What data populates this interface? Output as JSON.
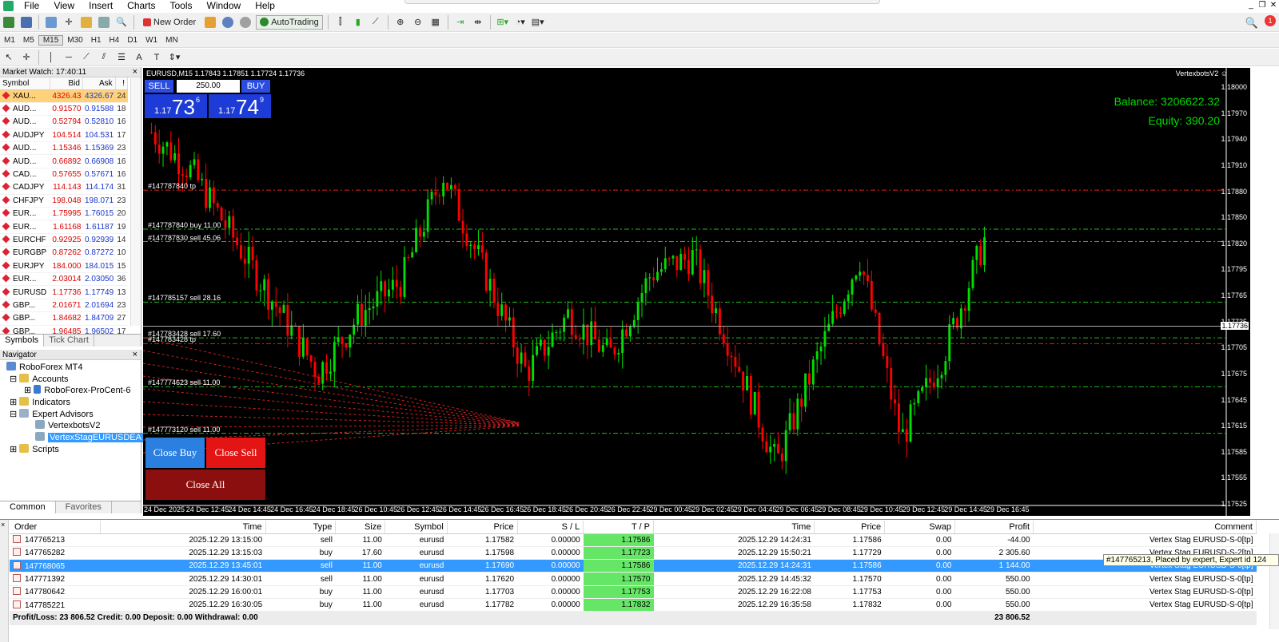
{
  "menu": [
    "File",
    "View",
    "Insert",
    "Charts",
    "Tools",
    "Window",
    "Help"
  ],
  "toolbar": {
    "new_order": "New Order",
    "autotrading": "AutoTrading"
  },
  "timeframes": [
    "M1",
    "M5",
    "M15",
    "M30",
    "H1",
    "H4",
    "D1",
    "W1",
    "MN"
  ],
  "market_watch": {
    "title": "Market Watch: 17:40:11",
    "headers": [
      "Symbol",
      "Bid",
      "Ask",
      "!"
    ],
    "rows": [
      {
        "sym": "XAU...",
        "bid": "4326.43",
        "ask": "4326.67",
        "sp": "24",
        "hl": true
      },
      {
        "sym": "AUD...",
        "bid": "0.91570",
        "ask": "0.91588",
        "sp": "18"
      },
      {
        "sym": "AUD...",
        "bid": "0.52794",
        "ask": "0.52810",
        "sp": "16"
      },
      {
        "sym": "AUDJPY",
        "bid": "104.514",
        "ask": "104.531",
        "sp": "17"
      },
      {
        "sym": "AUD...",
        "bid": "1.15346",
        "ask": "1.15369",
        "sp": "23"
      },
      {
        "sym": "AUD...",
        "bid": "0.66892",
        "ask": "0.66908",
        "sp": "16"
      },
      {
        "sym": "CAD...",
        "bid": "0.57655",
        "ask": "0.57671",
        "sp": "16"
      },
      {
        "sym": "CADJPY",
        "bid": "114.143",
        "ask": "114.174",
        "sp": "31"
      },
      {
        "sym": "CHFJPY",
        "bid": "198.048",
        "ask": "198.071",
        "sp": "23"
      },
      {
        "sym": "EUR...",
        "bid": "1.75995",
        "ask": "1.76015",
        "sp": "20"
      },
      {
        "sym": "EUR...",
        "bid": "1.61168",
        "ask": "1.61187",
        "sp": "19"
      },
      {
        "sym": "EURCHF",
        "bid": "0.92925",
        "ask": "0.92939",
        "sp": "14"
      },
      {
        "sym": "EURGBP",
        "bid": "0.87262",
        "ask": "0.87272",
        "sp": "10"
      },
      {
        "sym": "EURJPY",
        "bid": "184.000",
        "ask": "184.015",
        "sp": "15"
      },
      {
        "sym": "EUR...",
        "bid": "2.03014",
        "ask": "2.03050",
        "sp": "36"
      },
      {
        "sym": "EURUSD",
        "bid": "1.17736",
        "ask": "1.17749",
        "sp": "13"
      },
      {
        "sym": "GBP...",
        "bid": "2.01671",
        "ask": "2.01694",
        "sp": "23"
      },
      {
        "sym": "GBP...",
        "bid": "1.84682",
        "ask": "1.84709",
        "sp": "27"
      },
      {
        "sym": "GBP...",
        "bid": "1.96485",
        "ask": "1.96502",
        "sp": "17"
      }
    ],
    "tabs": [
      "Symbols",
      "Tick Chart"
    ]
  },
  "navigator": {
    "title": "Navigator",
    "root": "RoboForex MT4",
    "accounts": "Accounts",
    "account": "RoboForex-ProCent-6",
    "indicators": "Indicators",
    "experts": "Expert Advisors",
    "ea1": "VertexbotsV2",
    "ea2": "VertexStagEURUSDEA",
    "scripts": "Scripts",
    "tabs": [
      "Common",
      "Favorites"
    ]
  },
  "chart": {
    "title": "EURUSD,M15  1.17843 1.17851 1.17724 1.17736",
    "expert": "VertexbotsV2 ☺",
    "balance": "Balance: 3206622.32",
    "equity": "Equity: 390.20",
    "sell": "SELL",
    "buy": "BUY",
    "lot": "250.00",
    "bid_small": "1.17",
    "bid_big": "73",
    "bid_sup": "6",
    "ask_small": "1.17",
    "ask_big": "74",
    "ask_sup": "9",
    "close_buy": "Close Buy",
    "close_sell": "Close Sell",
    "close_all": "Close All",
    "current_price": "1.17736",
    "price_labels": [
      "1.18000",
      "1.17970",
      "1.17940",
      "1.17910",
      "1.17880",
      "1.17850",
      "1.17820",
      "1.17795",
      "1.17765",
      "1.17735",
      "1.17705",
      "1.17675",
      "1.17645",
      "1.17615",
      "1.17585",
      "1.17555",
      "1.17525"
    ],
    "time_labels": [
      "24 Dec 2025",
      "24 Dec 12:45",
      "24 Dec 14:45",
      "24 Dec 16:45",
      "24 Dec 18:45",
      "26 Dec 10:45",
      "26 Dec 12:45",
      "26 Dec 14:45",
      "26 Dec 16:45",
      "26 Dec 18:45",
      "26 Dec 20:45",
      "26 Dec 22:45",
      "29 Dec 00:45",
      "29 Dec 02:45",
      "29 Dec 04:45",
      "29 Dec 06:45",
      "29 Dec 08:45",
      "29 Dec 10:45",
      "29 Dec 12:45",
      "29 Dec 14:45",
      "29 Dec 16:45"
    ],
    "order_lines": [
      {
        "label": "#147787840 tp",
        "price": 1.179,
        "color": "#e02020"
      },
      {
        "label": "#147787840 buy 11.00",
        "price": 1.17853,
        "color": "#22bb22"
      },
      {
        "label": "#147787830 sell 45.06",
        "price": 1.17838,
        "color": "#22bb22"
      },
      {
        "label": "#147785157 sell 28.16",
        "price": 1.17765,
        "color": "#22bb22"
      },
      {
        "label": "#147783428 sell 17.60",
        "price": 1.17722,
        "color": "#22bb22"
      },
      {
        "label": "#147783428 tp",
        "price": 1.17715,
        "color": "#e02020"
      },
      {
        "label": "#147774623 sell 11.00",
        "price": 1.17663,
        "color": "#22bb22"
      },
      {
        "label": "#147773120 sell 11.00",
        "price": 1.17607,
        "color": "#22bb22"
      }
    ]
  },
  "chart_data": {
    "type": "line",
    "title": "EURUSD,M15",
    "ylim": [
      1.1752,
      1.1803
    ],
    "x": [
      "24 Dec 2025",
      "24 Dec 12:45",
      "24 Dec 14:45",
      "24 Dec 16:45",
      "24 Dec 18:45",
      "26 Dec 10:45",
      "26 Dec 12:45",
      "26 Dec 14:45",
      "26 Dec 16:45",
      "26 Dec 18:45",
      "26 Dec 20:45",
      "26 Dec 22:45",
      "29 Dec 00:45",
      "29 Dec 02:45",
      "29 Dec 04:45",
      "29 Dec 06:45",
      "29 Dec 08:45",
      "29 Dec 10:45",
      "29 Dec 12:45",
      "29 Dec 14:45",
      "29 Dec 16:45"
    ],
    "series": [
      {
        "values": [
          1.1797,
          1.1792,
          1.1784,
          1.1776,
          1.1768,
          1.1775,
          1.1779,
          1.1792,
          1.178,
          1.1768,
          1.1775,
          1.177,
          1.178,
          1.1782,
          1.177,
          1.1757,
          1.177,
          1.1782,
          1.176,
          1.177,
          1.1784
        ]
      }
    ]
  },
  "terminal": {
    "headers": [
      "Order",
      "Time",
      "Type",
      "Size",
      "Symbol",
      "Price",
      "S / L",
      "T / P",
      "Time",
      "Price",
      "Swap",
      "Profit",
      "Comment"
    ],
    "rows": [
      [
        "147765213",
        "2025.12.29 13:15:00",
        "sell",
        "11.00",
        "eurusd",
        "1.17582",
        "0.00000",
        "1.17586",
        "2025.12.29 14:24:31",
        "1.17586",
        "0.00",
        "-44.00",
        "Vertex Stag EURUSD-S-0[tp]"
      ],
      [
        "147765282",
        "2025.12.29 13:15:03",
        "buy",
        "17.60",
        "eurusd",
        "1.17598",
        "0.00000",
        "1.17723",
        "2025.12.29 15:50:21",
        "1.17729",
        "0.00",
        "2 305.60",
        "Vertex Stag EURUSD-S-2[tp]"
      ],
      [
        "147768065",
        "2025.12.29 13:45:01",
        "sell",
        "11.00",
        "eurusd",
        "1.17690",
        "0.00000",
        "1.17586",
        "2025.12.29 14:24:31",
        "1.17586",
        "0.00",
        "1 144.00",
        "Vertex Stag EURUSD-S-0[tp]"
      ],
      [
        "147771392",
        "2025.12.29 14:30:01",
        "sell",
        "11.00",
        "eurusd",
        "1.17620",
        "0.00000",
        "1.17570",
        "2025.12.29 14:45:32",
        "1.17570",
        "0.00",
        "550.00",
        "Vertex Stag EURUSD-S-0[tp]"
      ],
      [
        "147780642",
        "2025.12.29 16:00:01",
        "buy",
        "11.00",
        "eurusd",
        "1.17703",
        "0.00000",
        "1.17753",
        "2025.12.29 16:22:08",
        "1.17753",
        "0.00",
        "550.00",
        "Vertex Stag EURUSD-S-0[tp]"
      ],
      [
        "147785221",
        "2025.12.29 16:30:05",
        "buy",
        "11.00",
        "eurusd",
        "1.17782",
        "0.00000",
        "1.17832",
        "2025.12.29 16:35:58",
        "1.17832",
        "0.00",
        "550.00",
        "Vertex Stag EURUSD-S-0[tp]"
      ]
    ],
    "summary": "Profit/Loss: 23 806.52  Credit: 0.00  Deposit: 0.00  Withdrawal: 0.00",
    "summary_total": "23 806.52",
    "tooltip": "#147765213, Placed by expert, Expert id 124"
  }
}
